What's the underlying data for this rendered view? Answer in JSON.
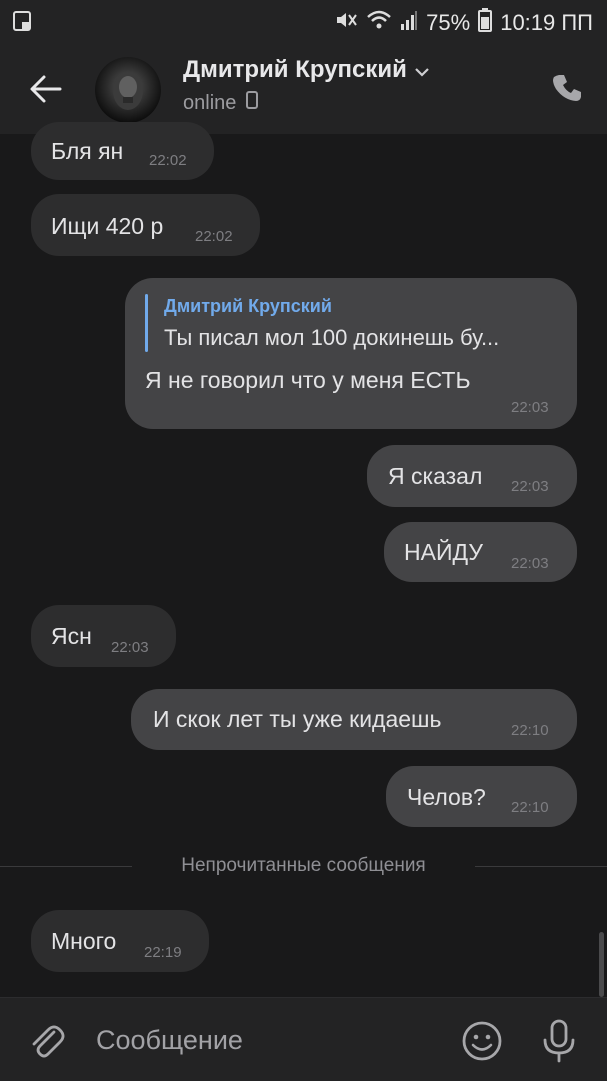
{
  "status_bar": {
    "battery": "75%",
    "time": "10:19 ПП"
  },
  "header": {
    "name": "Дмитрий Крупский",
    "status": "online"
  },
  "messages": [
    {
      "text": "Бля ян",
      "time": "22:02",
      "outgoing": false
    },
    {
      "text": "Ищи 420 р",
      "time": "22:02",
      "outgoing": false
    },
    {
      "reply_author": "Дмитрий Крупский",
      "reply_text": "Ты писал мол 100 докинешь бу...",
      "text": "Я не говорил что у меня ЕСТЬ",
      "time": "22:03",
      "outgoing": true
    },
    {
      "text": "Я сказал",
      "time": "22:03",
      "outgoing": true
    },
    {
      "text": "НАЙДУ",
      "time": "22:03",
      "outgoing": true
    },
    {
      "text": "Ясн",
      "time": "22:03",
      "outgoing": false
    },
    {
      "text": "И скок лет ты уже кидаешь",
      "time": "22:10",
      "outgoing": true
    },
    {
      "text": "Челов?",
      "time": "22:10",
      "outgoing": true
    },
    {
      "text": "Много",
      "time": "22:19",
      "outgoing": false
    }
  ],
  "divider": "Непрочитанные сообщения",
  "composer": {
    "placeholder": "Сообщение"
  },
  "colors": {
    "background": "#19191a",
    "bar": "#232324",
    "incoming_bubble": "#2d2d2e",
    "outgoing_bubble": "#444446",
    "accent": "#71aaeb"
  }
}
